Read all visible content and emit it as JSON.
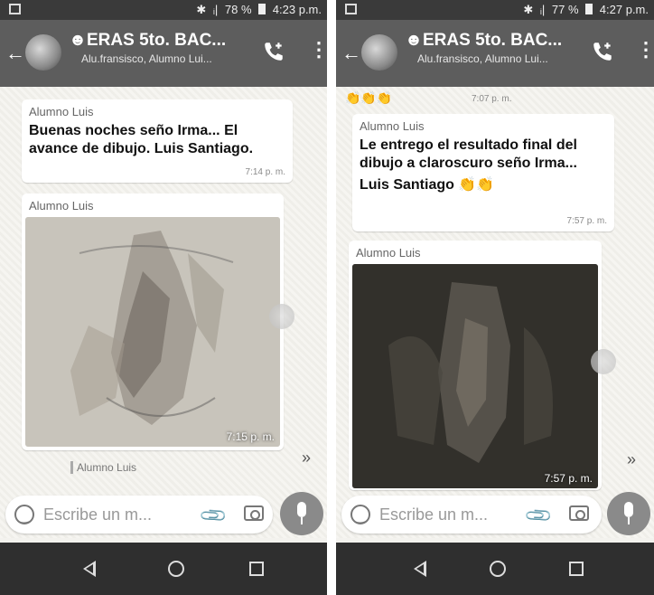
{
  "left": {
    "status": {
      "signal": "ᵢ|",
      "battery": "78 %",
      "time": "4:23 p.m."
    },
    "header": {
      "title": "ERAS 5to. BAC...",
      "subtitle": "Alu.fransisco, Alumno Lui..."
    },
    "messages": [
      {
        "sender": "Alumno Luis",
        "text": "Buenas noches seño Irma... El avance de dibujo. Luis Santiago.",
        "time": "7:14 p. m."
      },
      {
        "sender": "Alumno Luis",
        "image_time": "7:15 p. m."
      }
    ],
    "typing_label": "Alumno Luis",
    "composer": {
      "placeholder": "Escribe un m..."
    }
  },
  "right": {
    "status": {
      "signal": "ᵢ|",
      "battery": "77 %",
      "time": "4:27 p.m."
    },
    "header": {
      "title": "ERAS 5to. BAC...",
      "subtitle": "Alu.fransisco, Alumno Lui..."
    },
    "top_emoji_time": "7:07 p. m.",
    "messages": [
      {
        "sender": "Alumno Luis",
        "text": "Le entrego el resultado final del dibujo a claroscuro seño Irma...",
        "signature": "Luis Santiago 👏👏",
        "time": "7:57 p. m."
      },
      {
        "sender": "Alumno Luis",
        "image_time": "7:57 p. m."
      }
    ],
    "composer": {
      "placeholder": "Escribe un m..."
    }
  },
  "icons": {
    "scroll_down": "»",
    "attach": "📎",
    "top_emojis": "👏👏👏"
  }
}
